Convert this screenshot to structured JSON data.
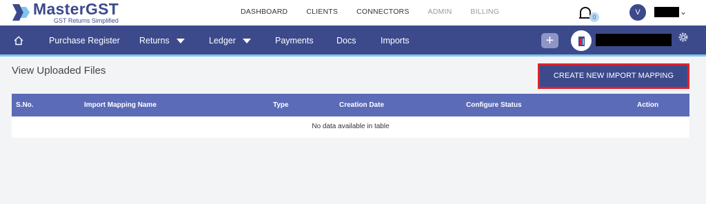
{
  "brand": {
    "name": "MasterGST",
    "tagline": "GST Returns Simplified",
    "accent": "#3c4a8c"
  },
  "top_nav": {
    "items": [
      {
        "label": "DASHBOARD",
        "muted": false
      },
      {
        "label": "CLIENTS",
        "muted": false
      },
      {
        "label": "CONNECTORS",
        "muted": false
      },
      {
        "label": "ADMIN",
        "muted": true
      },
      {
        "label": "BILLING",
        "muted": true
      }
    ],
    "notification_count": "0",
    "user_initial": "V"
  },
  "main_nav": {
    "items": [
      {
        "label": "Purchase Register",
        "has_dropdown": false
      },
      {
        "label": "Returns",
        "has_dropdown": true
      },
      {
        "label": "Ledger",
        "has_dropdown": true
      },
      {
        "label": "Payments",
        "has_dropdown": false
      },
      {
        "label": "Docs",
        "has_dropdown": false
      },
      {
        "label": "Imports",
        "has_dropdown": false
      }
    ],
    "plus_label": "+",
    "background": "#3c4a8c",
    "underline": "#7fc6ee"
  },
  "page": {
    "title": "View Uploaded Files",
    "create_button": "CREATE NEW IMPORT MAPPING"
  },
  "table": {
    "columns": [
      "S.No.",
      "Import Mapping Name",
      "Type",
      "Creation Date",
      "Configure Status",
      "Action"
    ],
    "empty_message": "No data available in table",
    "header_color": "#5b6bb8"
  }
}
